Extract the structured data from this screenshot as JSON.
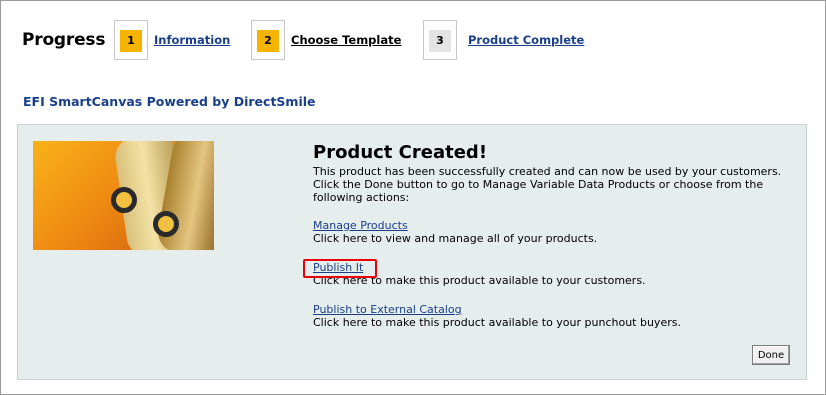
{
  "header": {
    "title": "Progress",
    "steps": [
      {
        "number": "1",
        "label": "Information"
      },
      {
        "number": "2",
        "label": "Choose Template"
      },
      {
        "number": "3",
        "label": "Product Complete"
      }
    ]
  },
  "subtitle": "EFI SmartCanvas Powered by DirectSmile",
  "panel": {
    "heading": "Product Created!",
    "description": "This product has been successfully created and can now be used by your customers. Click the Done button to go to Manage Variable Data Products or choose from the following actions:",
    "actions": [
      {
        "label": "Manage Products",
        "description": "Click here to view and manage all of your products."
      },
      {
        "label": "Publish It",
        "description": "Click here to make this product available to your customers."
      },
      {
        "label": "Publish to External Catalog",
        "description": "Click here to make this product available to your punchout buyers."
      }
    ],
    "done_label": "Done"
  },
  "colors": {
    "active_step": "#f5b400",
    "inactive_step": "#e4e4e4",
    "link": "#1a3f8a",
    "panel_bg": "#e5eded",
    "highlight": "#e8000b"
  }
}
